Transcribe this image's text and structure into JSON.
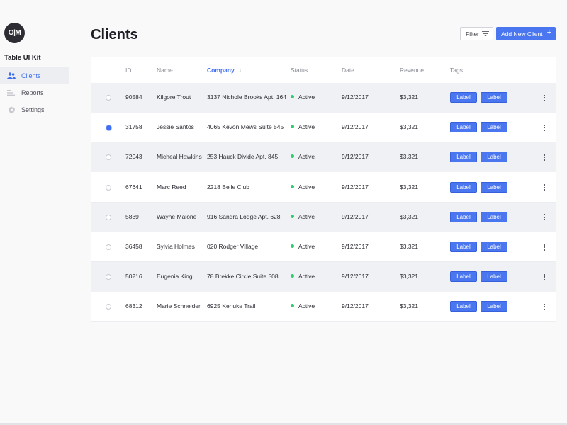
{
  "sidebar": {
    "logo": "O|M",
    "title": "Table UI Kit",
    "items": [
      {
        "label": "Clients",
        "icon": "users-icon",
        "active": true
      },
      {
        "label": "Reports",
        "icon": "bar-chart-icon",
        "active": false
      },
      {
        "label": "Settings",
        "icon": "gear-icon",
        "active": false
      }
    ]
  },
  "header": {
    "title": "Clients",
    "filter_label": "Filter",
    "add_label": "Add New Client"
  },
  "table": {
    "columns": [
      "ID",
      "Name",
      "Company",
      "Status",
      "Date",
      "Revenue",
      "Tags"
    ],
    "sorted_column": "Company",
    "rows": [
      {
        "selected": false,
        "id": "90584",
        "name": "Kilgore Trout",
        "company": "3137 Nichole Brooks Apt. 164",
        "status": "Active",
        "date": "9/12/2017",
        "revenue": "$3,321",
        "tags": [
          "Label",
          "Label"
        ]
      },
      {
        "selected": true,
        "id": "31758",
        "name": "Jessie Santos",
        "company": "4065 Kevon Mews Suite 545",
        "status": "Active",
        "date": "9/12/2017",
        "revenue": "$3,321",
        "tags": [
          "Label",
          "Label"
        ]
      },
      {
        "selected": false,
        "id": "72043",
        "name": "Micheal Hawkins",
        "company": "253 Hauck Divide Apt. 845",
        "status": "Active",
        "date": "9/12/2017",
        "revenue": "$3,321",
        "tags": [
          "Label",
          "Label"
        ]
      },
      {
        "selected": false,
        "id": "67641",
        "name": "Marc Reed",
        "company": "2218 Belle Club",
        "status": "Active",
        "date": "9/12/2017",
        "revenue": "$3,321",
        "tags": [
          "Label",
          "Label"
        ]
      },
      {
        "selected": false,
        "id": "5839",
        "name": "Wayne Malone",
        "company": "916 Sandra Lodge Apt. 628",
        "status": "Active",
        "date": "9/12/2017",
        "revenue": "$3,321",
        "tags": [
          "Label",
          "Label"
        ]
      },
      {
        "selected": false,
        "id": "36458",
        "name": "Sylvia Holmes",
        "company": "020 Rodger Village",
        "status": "Active",
        "date": "9/12/2017",
        "revenue": "$3,321",
        "tags": [
          "Label",
          "Label"
        ]
      },
      {
        "selected": false,
        "id": "50216",
        "name": "Eugenia King",
        "company": "78 Brekke Circle Suite 508",
        "status": "Active",
        "date": "9/12/2017",
        "revenue": "$3,321",
        "tags": [
          "Label",
          "Label"
        ]
      },
      {
        "selected": false,
        "id": "68312",
        "name": "Marie Schneider",
        "company": "6925 Kerluke Trail",
        "status": "Active",
        "date": "9/12/2017",
        "revenue": "$3,321",
        "tags": [
          "Label",
          "Label"
        ]
      }
    ]
  },
  "colors": {
    "accent": "#4a76f0",
    "status_active": "#2ecc71",
    "row_alt": "#f0f1f4"
  }
}
